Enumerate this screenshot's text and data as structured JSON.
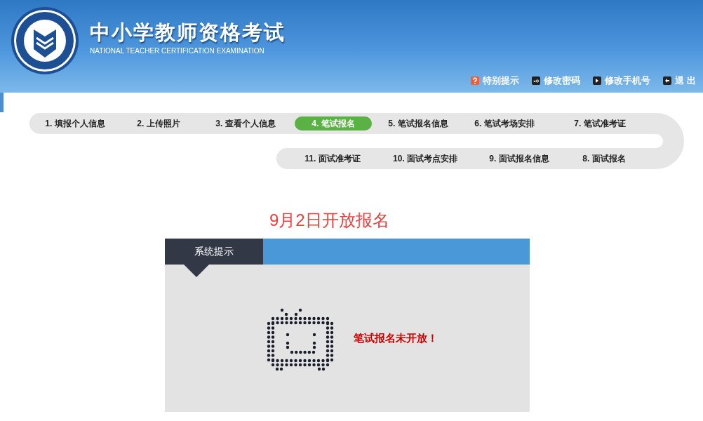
{
  "header": {
    "title": "中小学教师资格考试",
    "subtitle": "NATIONAL TEACHER CERTIFICATION EXAMINATION",
    "links": [
      {
        "kind": "help",
        "label": "特别提示"
      },
      {
        "kind": "password",
        "label": "修改密码"
      },
      {
        "kind": "phone",
        "label": "修改手机号"
      },
      {
        "kind": "logout",
        "label": "退 出"
      }
    ]
  },
  "step_rows": [
    {
      "steps": [
        {
          "label": "1. 填报个人信息",
          "selected": false
        },
        {
          "label": "2. 上传照片",
          "selected": false
        },
        {
          "label": "3. 查看个人信息",
          "selected": false
        },
        {
          "label": "4. 笔试报名",
          "selected": true
        },
        {
          "label": "5. 笔试报名信息",
          "selected": false
        },
        {
          "label": "6. 笔试考场安排",
          "selected": false
        },
        {
          "label": "7. 笔试准考证",
          "selected": false
        }
      ]
    },
    {
      "steps": [
        {
          "label": "11. 面试准考证",
          "selected": false
        },
        {
          "label": "10. 面试考点安排",
          "selected": false
        },
        {
          "label": "9. 面试报名信息",
          "selected": false
        },
        {
          "label": "8. 面试报名",
          "selected": false
        }
      ]
    }
  ],
  "notice": "9月2日开放报名",
  "panel": {
    "tab": "系统提示",
    "message": "笔试报名未开放！"
  }
}
